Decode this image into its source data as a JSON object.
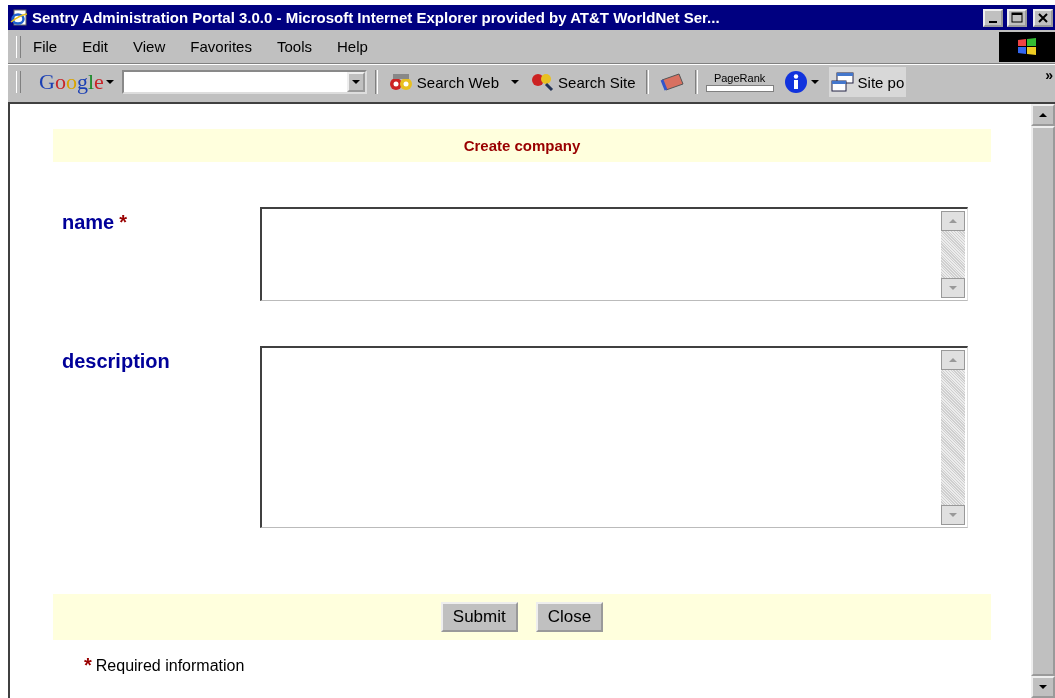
{
  "window": {
    "title": "Sentry Administration Portal 3.0.0 - Microsoft Internet Explorer provided by AT&T WorldNet Ser..."
  },
  "menu": [
    {
      "label": "File"
    },
    {
      "label": "Edit"
    },
    {
      "label": "View"
    },
    {
      "label": "Favorites"
    },
    {
      "label": "Tools"
    },
    {
      "label": "Help"
    }
  ],
  "google_toolbar": {
    "logo": "Google",
    "search_web": "Search Web",
    "search_site": "Search Site",
    "pagerank": {
      "label": "PageRank",
      "level": 0
    },
    "site_popup": "Site po",
    "more": "»"
  },
  "form": {
    "title": "Create company",
    "required_mark": "*",
    "fields": [
      {
        "label": "name",
        "required": true,
        "kind": "short"
      },
      {
        "label": "description",
        "required": false,
        "kind": "tall"
      }
    ],
    "buttons": [
      "Submit",
      "Close"
    ],
    "footnote": "Required information"
  }
}
